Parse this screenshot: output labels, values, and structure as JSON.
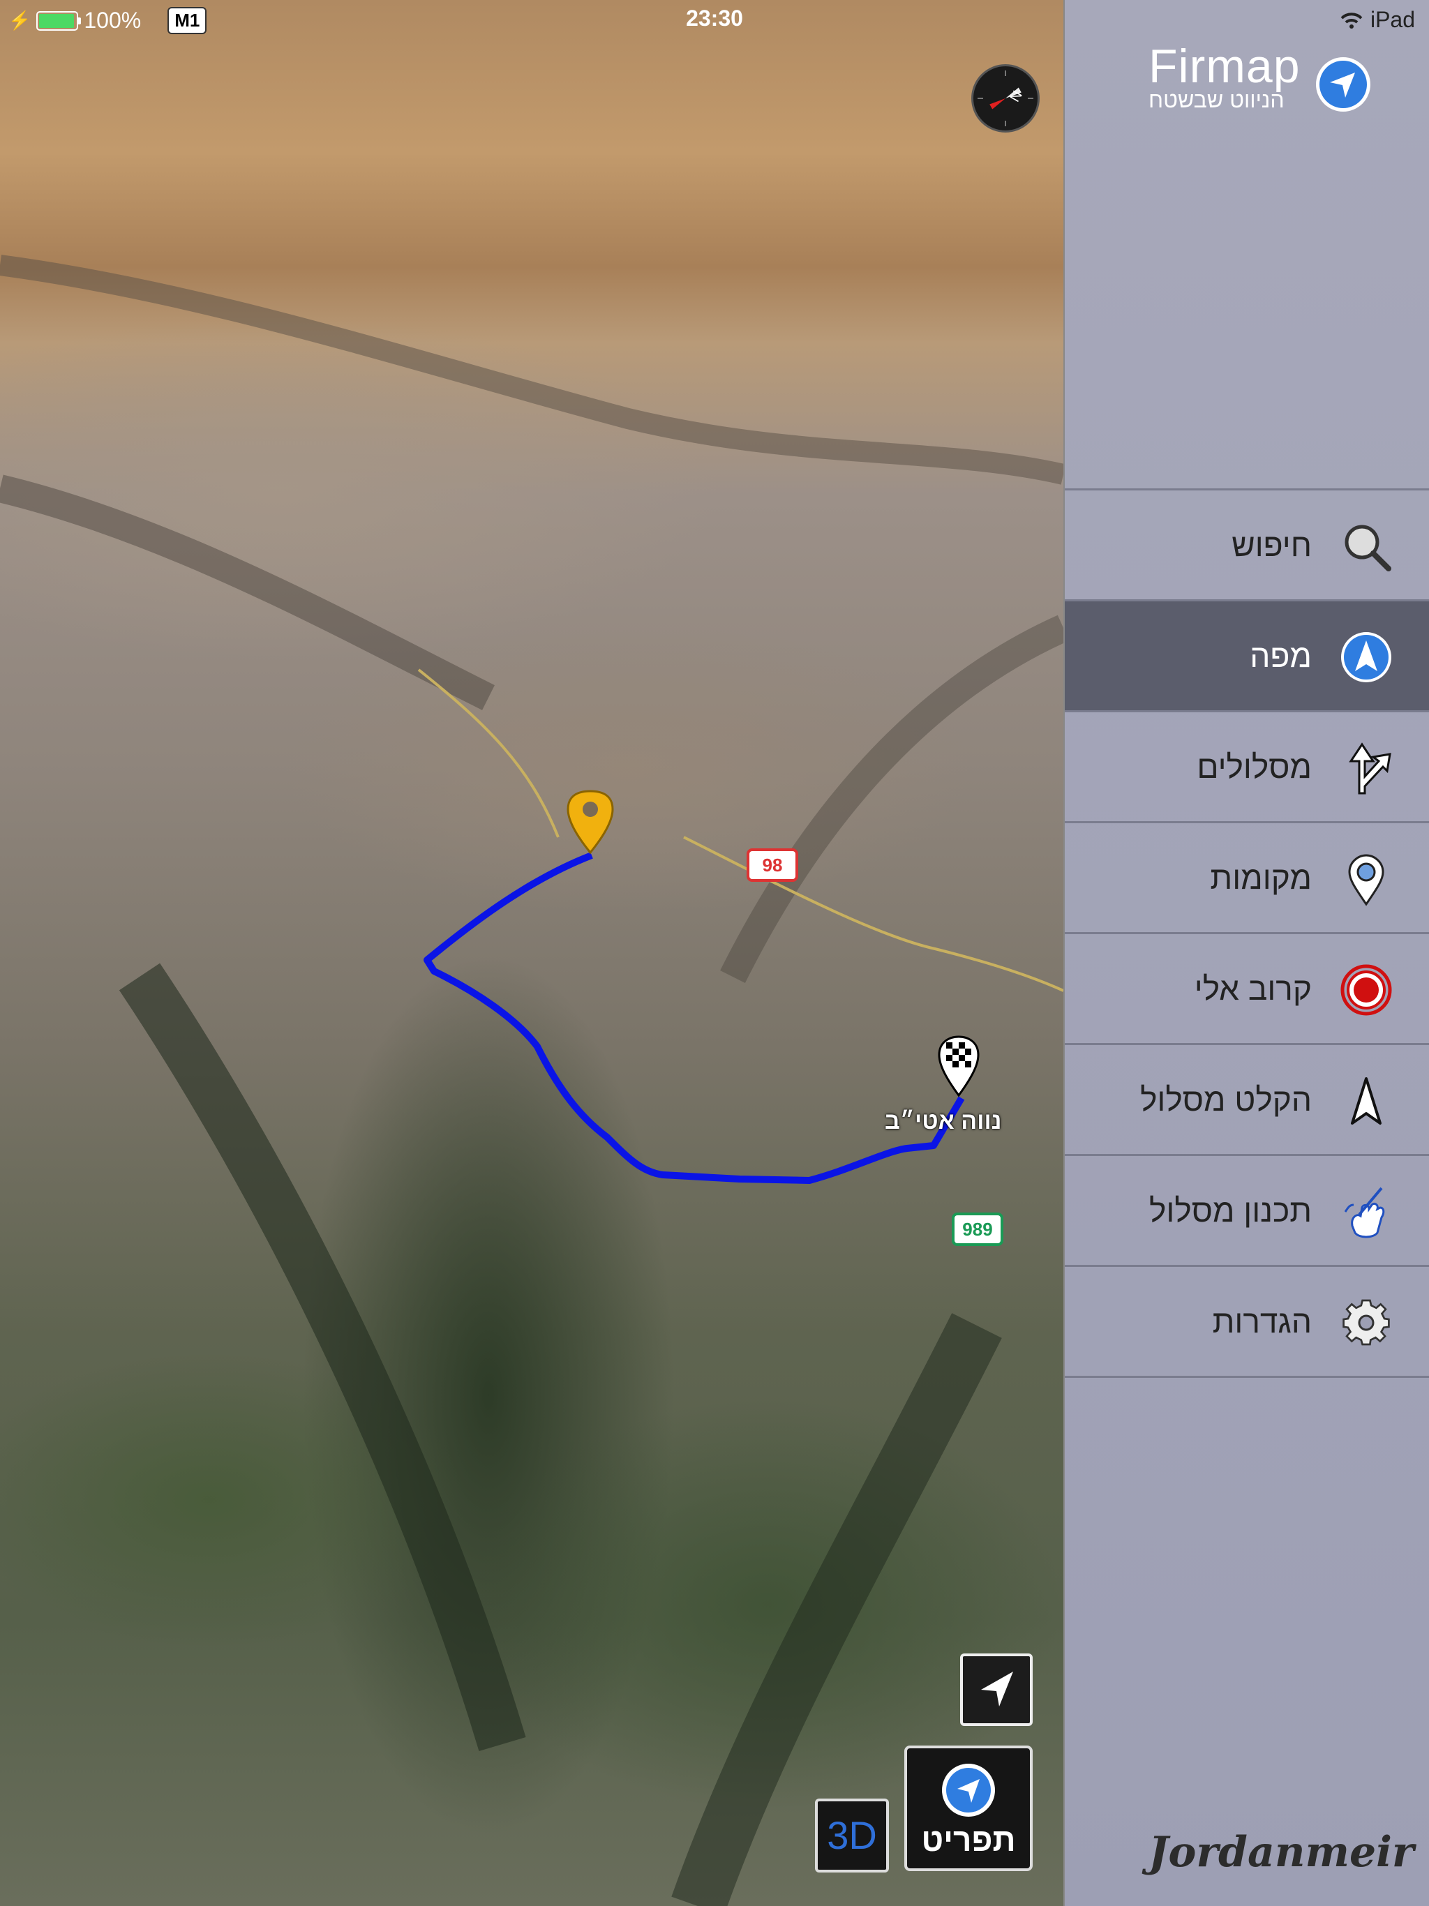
{
  "status_bar": {
    "battery_percent": "100%",
    "carrier_badge": "M1",
    "time": "23:30",
    "device": "iPad",
    "battery_level": 1.0
  },
  "map": {
    "place_label": "נווה אטי״ב",
    "road_shield_1": "98",
    "road_shield_2": "989",
    "route_color": "#0a14e6",
    "start_pin_color": "#f1b10e",
    "compass_icon": "compass-icon"
  },
  "controls": {
    "three_d_label": "3D",
    "menu_button_label": "תפריט",
    "locate_icon": "location-arrow-icon"
  },
  "sidebar": {
    "brand_name": "Firmap",
    "brand_tagline": "הניווט שבשטח",
    "signature": "Jordanmeir",
    "items": [
      {
        "label": "חיפוש",
        "icon": "search-icon",
        "active": false
      },
      {
        "label": "מפה",
        "icon": "navigation-arrow-icon",
        "active": true
      },
      {
        "label": "מסלולים",
        "icon": "routes-fork-icon",
        "active": false
      },
      {
        "label": "מקומות",
        "icon": "location-pin-icon",
        "active": false
      },
      {
        "label": "קרוב אלי",
        "icon": "target-icon",
        "active": false
      },
      {
        "label": "הקלט מסלול",
        "icon": "record-arrow-icon",
        "active": false
      },
      {
        "label": "תכנון מסלול",
        "icon": "hand-pen-icon",
        "active": false
      },
      {
        "label": "הגדרות",
        "icon": "gear-icon",
        "active": false
      }
    ]
  }
}
